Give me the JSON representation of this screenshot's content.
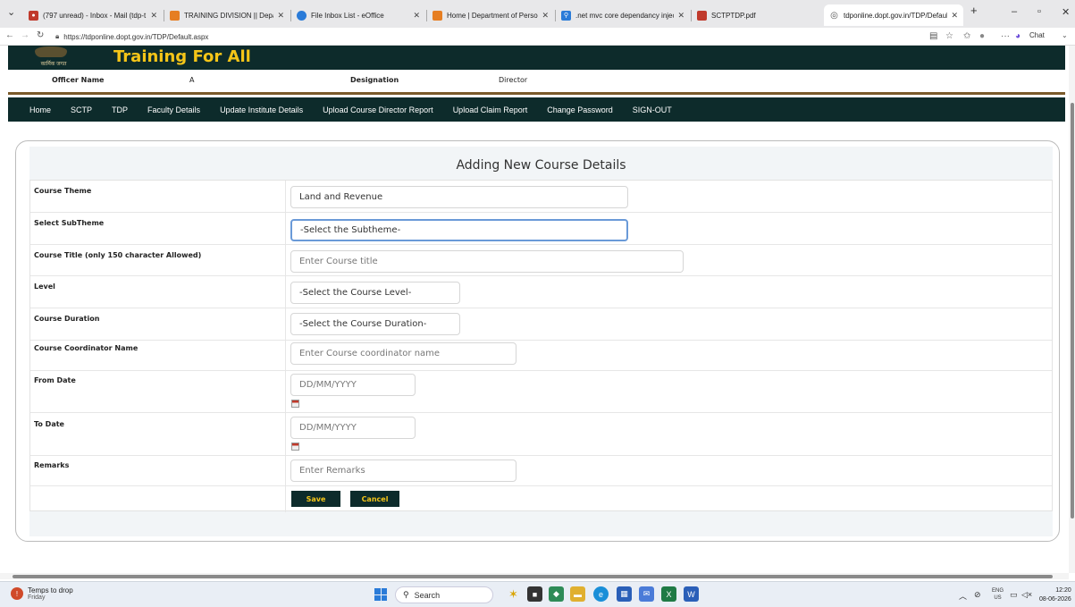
{
  "browser": {
    "tabs": [
      {
        "title": "(797 unread) - Inbox - Mail (tdp-t",
        "icon": "mail-icon",
        "color": "#c0392b"
      },
      {
        "title": "TRAINING DIVISION || Departmen",
        "icon": "flag-icon",
        "color": "#e67e22"
      },
      {
        "title": "File Inbox List - eOffice",
        "icon": "eoffice-icon",
        "color": "#2a7bd8"
      },
      {
        "title": "Home | Department of Personnel",
        "icon": "flag-icon",
        "color": "#e67e22"
      },
      {
        "title": ".net mvc core dependancy injectio",
        "icon": "search-icon",
        "color": "#2a7bd8"
      },
      {
        "title": "SCTPTDP.pdf",
        "icon": "pdf-icon",
        "color": "#c0392b"
      },
      {
        "title": "tdponline.dopt.gov.in/TDP/Defaul",
        "icon": "globe-icon",
        "color": "#555555"
      }
    ],
    "url": "https://tdponline.dopt.gov.in/TDP/Default.aspx",
    "chat_label": "Chat"
  },
  "site": {
    "logo_text": "कार्मिक जगत",
    "title": "Training For All"
  },
  "officer": {
    "name_label": "Officer Name",
    "name_value": "A",
    "designation_label": "Designation",
    "designation_value": "Director"
  },
  "nav": [
    "Home",
    "SCTP",
    "TDP",
    "Faculty Details",
    "Update Institute Details",
    "Upload Course Director Report",
    "Upload Claim Report",
    "Change Password",
    "SIGN-OUT"
  ],
  "form": {
    "title": "Adding New Course Details",
    "course_theme": {
      "label": "Course Theme",
      "value": "Land and Revenue"
    },
    "subtheme": {
      "label": "Select SubTheme",
      "value": "-Select the Subtheme-"
    },
    "course_title": {
      "label": "Course Title (only 150 character Allowed)",
      "placeholder": "Enter Course title"
    },
    "level": {
      "label": "Level",
      "value": "-Select the Course Level-"
    },
    "duration": {
      "label": "Course Duration",
      "value": "-Select the Course Duration-"
    },
    "coordinator": {
      "label": "Course Coordinator Name",
      "placeholder": "Enter Course coordinator name"
    },
    "from_date": {
      "label": "From Date",
      "placeholder": "DD/MM/YYYY"
    },
    "to_date": {
      "label": "To Date",
      "placeholder": "DD/MM/YYYY"
    },
    "remarks": {
      "label": "Remarks",
      "placeholder": "Enter Remarks"
    },
    "save_label": "Save",
    "cancel_label": "Cancel"
  },
  "taskbar": {
    "weather_title": "Temps to drop",
    "weather_day": "Friday",
    "search_label": "Search",
    "lang_top": "ENG",
    "lang_bottom": "US",
    "time": "12:20",
    "date": "08-06-2026"
  }
}
